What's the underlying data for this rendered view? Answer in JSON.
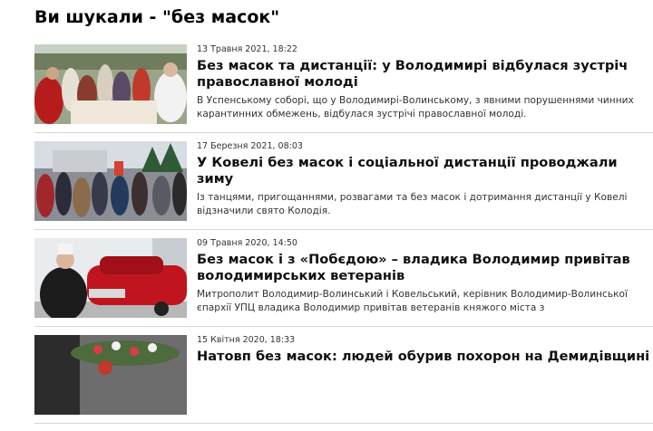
{
  "search": {
    "title": "Ви шукали - \"без масок\""
  },
  "results": [
    {
      "date": "13 Травня 2021, 18:22",
      "headline": "Без масок та дистанції: у Володимирі відбулася зустріч православної молоді",
      "summary": "В Успенському соборі, що у Володимирі-Волинському, з явними порушеннями чинних карантинних обмежень, відбулася зустрічі православної молоді."
    },
    {
      "date": "17 Березня 2021, 08:03",
      "headline": "У Ковелі без масок і соціальної дистанції проводжали зиму",
      "summary": "Із танцями, пригощаннями, розвагами та без масок і дотримання дистанції у Ковелі відзначили свято Колодія."
    },
    {
      "date": "09 Травня 2020, 14:50",
      "headline": "Без масок і з «Побєдою» – владика Володимир привітав володимирських ветеранів",
      "summary": "Митрополит Володимир-Волинський і Ковельський, керівник Володимир-Волинської єпархії УПЦ владика Володимир привітав ветеранів княжого міста з"
    },
    {
      "date": "15 Квітня 2020, 18:33",
      "headline": "Натовп без масок: людей обурив похорон на Демидівщині",
      "summary": ""
    }
  ]
}
